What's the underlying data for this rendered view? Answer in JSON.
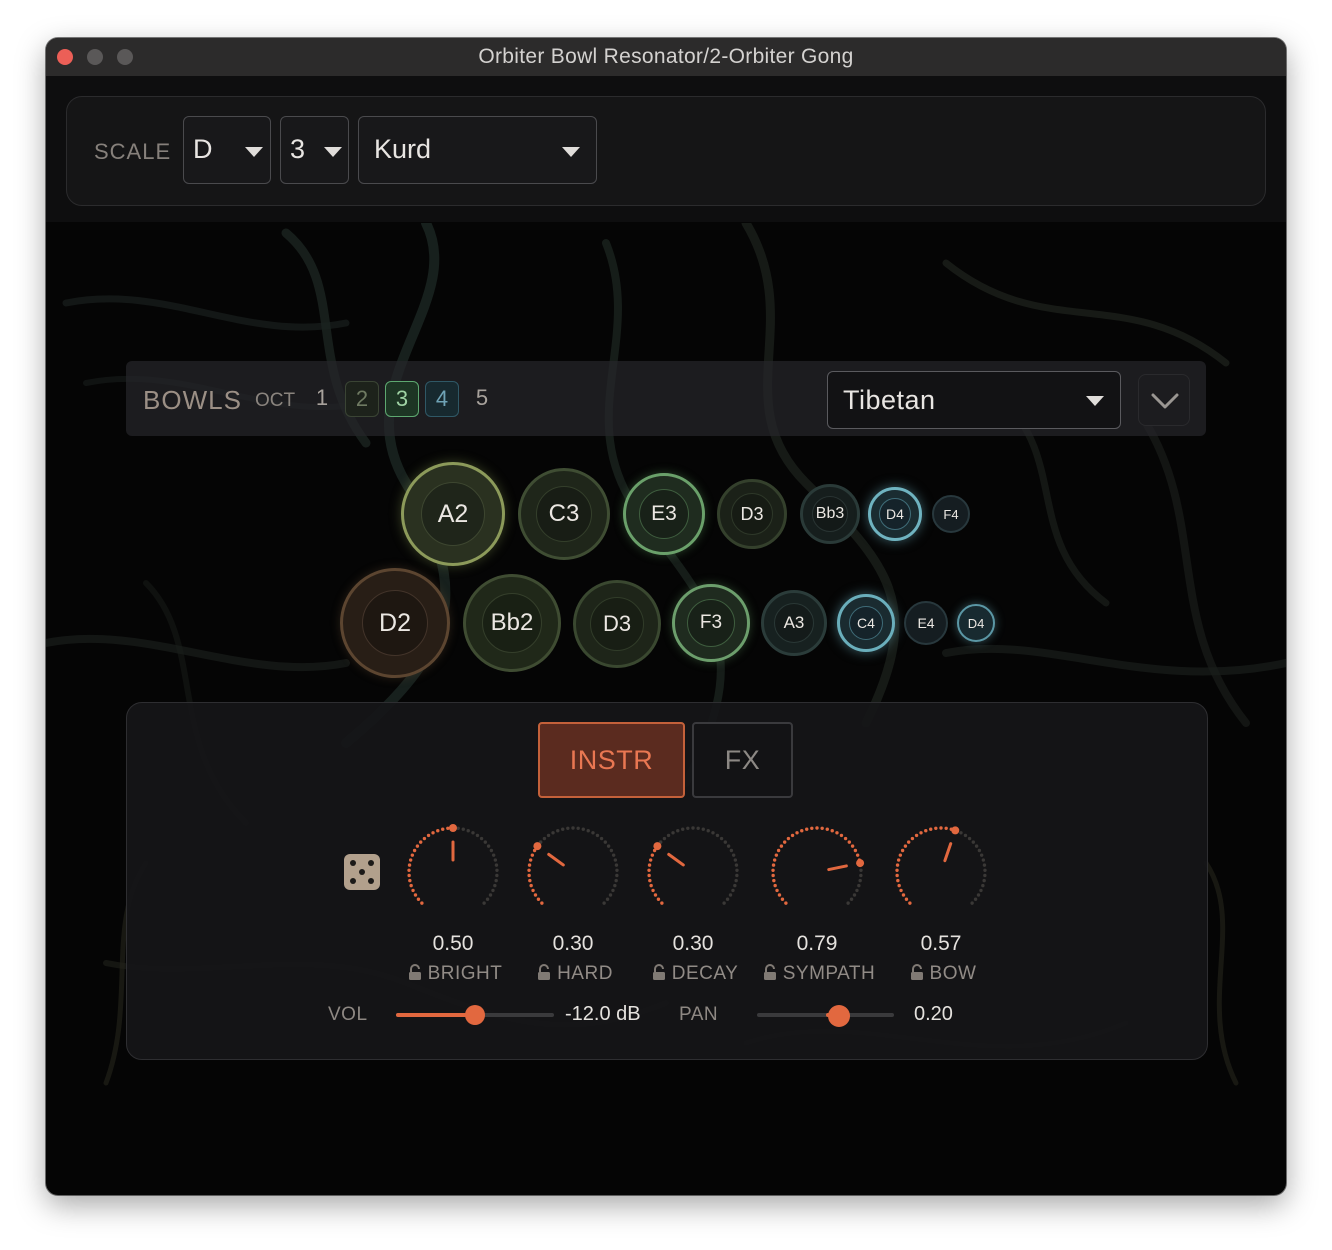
{
  "window": {
    "title": "Orbiter Bowl Resonator/2-Orbiter Gong"
  },
  "scale": {
    "label": "SCALE",
    "root": "D",
    "octave": "3",
    "mode": "Kurd"
  },
  "bowls": {
    "label": "BOWLS",
    "oct_label": "OCT",
    "octaves": [
      {
        "label": "1",
        "state": "off"
      },
      {
        "label": "2",
        "state": "on"
      },
      {
        "label": "3",
        "state": "on"
      },
      {
        "label": "4",
        "state": "on"
      },
      {
        "label": "5",
        "state": "off"
      }
    ],
    "type": "Tibetan",
    "row1": [
      "A2",
      "C3",
      "E3",
      "D3",
      "Bb3",
      "D4",
      "F4"
    ],
    "row2": [
      "D2",
      "Bb2",
      "D3",
      "F3",
      "A3",
      "C4",
      "E4",
      "D4"
    ]
  },
  "tabs": {
    "instr": "INSTR",
    "fx": "FX",
    "active": "instr"
  },
  "knobs": [
    {
      "name": "BRIGHT",
      "value": "0.50",
      "amount": 0.5
    },
    {
      "name": "HARD",
      "value": "0.30",
      "amount": 0.3
    },
    {
      "name": "DECAY",
      "value": "0.30",
      "amount": 0.3
    },
    {
      "name": "SYMPATH",
      "value": "0.79",
      "amount": 0.79
    },
    {
      "name": "BOW",
      "value": "0.57",
      "amount": 0.57
    }
  ],
  "vol": {
    "label": "VOL",
    "readout": "-12.0 dB",
    "level": 0.5
  },
  "pan": {
    "label": "PAN",
    "readout": "0.20",
    "level": 0.6
  },
  "colors": {
    "accent": "#e2683f",
    "panel": "#161618",
    "background": "#050505"
  },
  "icons": {
    "randomize": "dice-icon",
    "lock": "lock-icon",
    "collapse": "chevron-down-icon"
  }
}
